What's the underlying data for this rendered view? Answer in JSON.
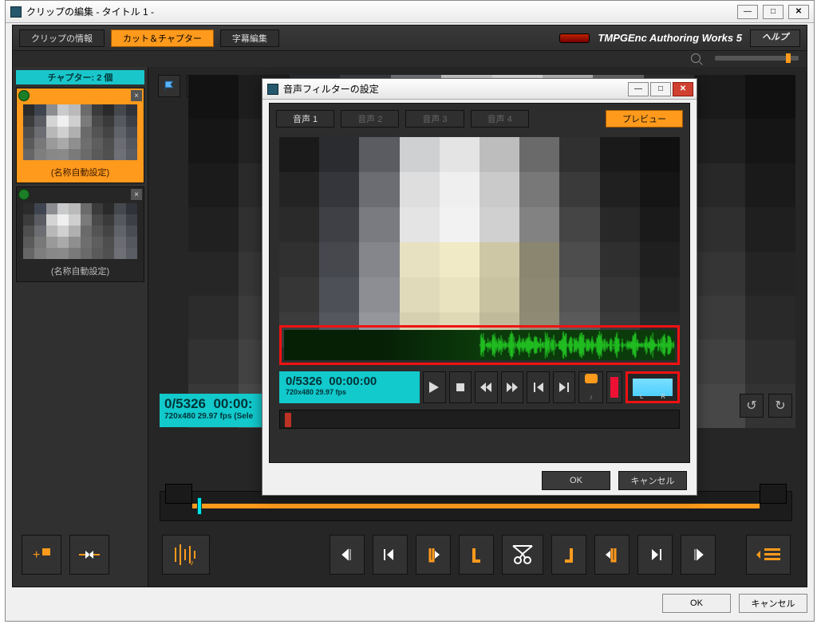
{
  "window": {
    "title": "クリップの編集 - タイトル 1 -",
    "ok": "OK",
    "cancel": "キャンセル"
  },
  "header": {
    "tab_info": "クリップの情報",
    "tab_cut": "カット＆チャプター",
    "tab_sub": "字幕編集",
    "brand": "TMPGEnc Authoring Works 5",
    "help": "ヘルプ"
  },
  "sidebar": {
    "head": "チャプター: 2 個",
    "cap1": "(名称自動設定)",
    "cap2": "(名称自動設定)"
  },
  "counter": {
    "frames": "0/5326",
    "time": "00:00:",
    "meta": "720x480 29.97 fps  (Sele"
  },
  "modal": {
    "title": "音声フィルターの設定",
    "tab1": "音声 1",
    "tab2": "音声 2",
    "tab3": "音声 3",
    "tab4": "音声 4",
    "preview": "プレビュー",
    "counter_frames": "0/5326",
    "counter_time": "00:00:00",
    "counter_meta": "720x480 29.97 fps",
    "level_L": "L",
    "level_R": "R",
    "ok": "OK",
    "cancel": "キャンセル"
  }
}
